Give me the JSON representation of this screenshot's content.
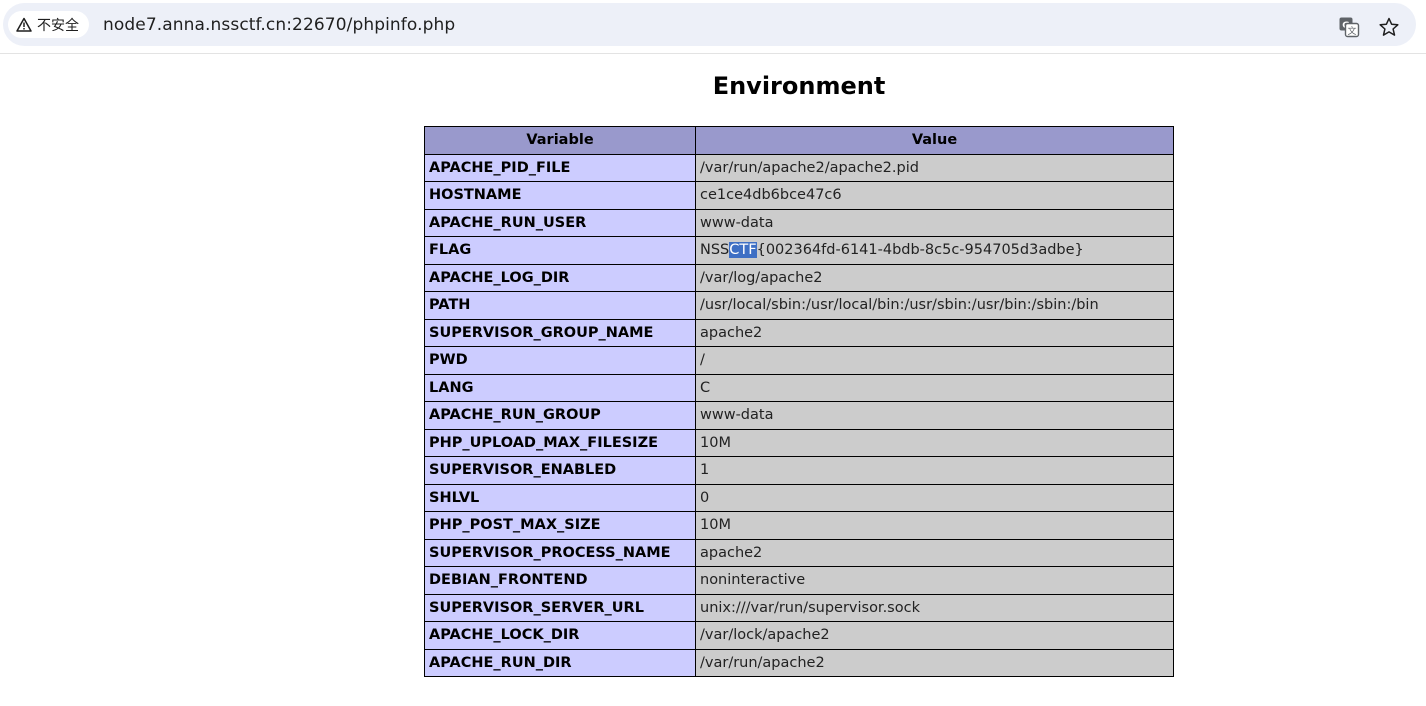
{
  "browser": {
    "security_label": "不安全",
    "url": "node7.anna.nssctf.cn:22670/phpinfo.php"
  },
  "page": {
    "title": "Environment",
    "headers": [
      "Variable",
      "Value"
    ],
    "flag_parts": {
      "before": "NSS",
      "selected": "CTF",
      "after": "{002364fd-6141-4bdb-8c5c-954705d3adbe}"
    },
    "rows": [
      {
        "name": "APACHE_PID_FILE",
        "value": "/var/run/apache2/apache2.pid"
      },
      {
        "name": "HOSTNAME",
        "value": "ce1ce4db6bce47c6"
      },
      {
        "name": "APACHE_RUN_USER",
        "value": "www-data"
      },
      {
        "name": "FLAG",
        "value": "NSSCTF{002364fd-6141-4bdb-8c5c-954705d3adbe}"
      },
      {
        "name": "APACHE_LOG_DIR",
        "value": "/var/log/apache2"
      },
      {
        "name": "PATH",
        "value": "/usr/local/sbin:/usr/local/bin:/usr/sbin:/usr/bin:/sbin:/bin"
      },
      {
        "name": "SUPERVISOR_GROUP_NAME",
        "value": "apache2"
      },
      {
        "name": "PWD",
        "value": "/"
      },
      {
        "name": "LANG",
        "value": "C"
      },
      {
        "name": "APACHE_RUN_GROUP",
        "value": "www-data"
      },
      {
        "name": "PHP_UPLOAD_MAX_FILESIZE",
        "value": "10M"
      },
      {
        "name": "SUPERVISOR_ENABLED",
        "value": "1"
      },
      {
        "name": "SHLVL",
        "value": "0"
      },
      {
        "name": "PHP_POST_MAX_SIZE",
        "value": "10M"
      },
      {
        "name": "SUPERVISOR_PROCESS_NAME",
        "value": "apache2"
      },
      {
        "name": "DEBIAN_FRONTEND",
        "value": "noninteractive"
      },
      {
        "name": "SUPERVISOR_SERVER_URL",
        "value": "unix:///var/run/supervisor.sock"
      },
      {
        "name": "APACHE_LOCK_DIR",
        "value": "/var/lock/apache2"
      },
      {
        "name": "APACHE_RUN_DIR",
        "value": "/var/run/apache2"
      }
    ]
  },
  "icons": {
    "warning": "warning-triangle-icon",
    "translate": "translate-icon",
    "bookmark": "star-icon"
  },
  "colors": {
    "header_bg": "#9999cc",
    "var_bg": "#ccccff",
    "value_bg": "#cccccc",
    "selection": "#3e6fc4"
  }
}
